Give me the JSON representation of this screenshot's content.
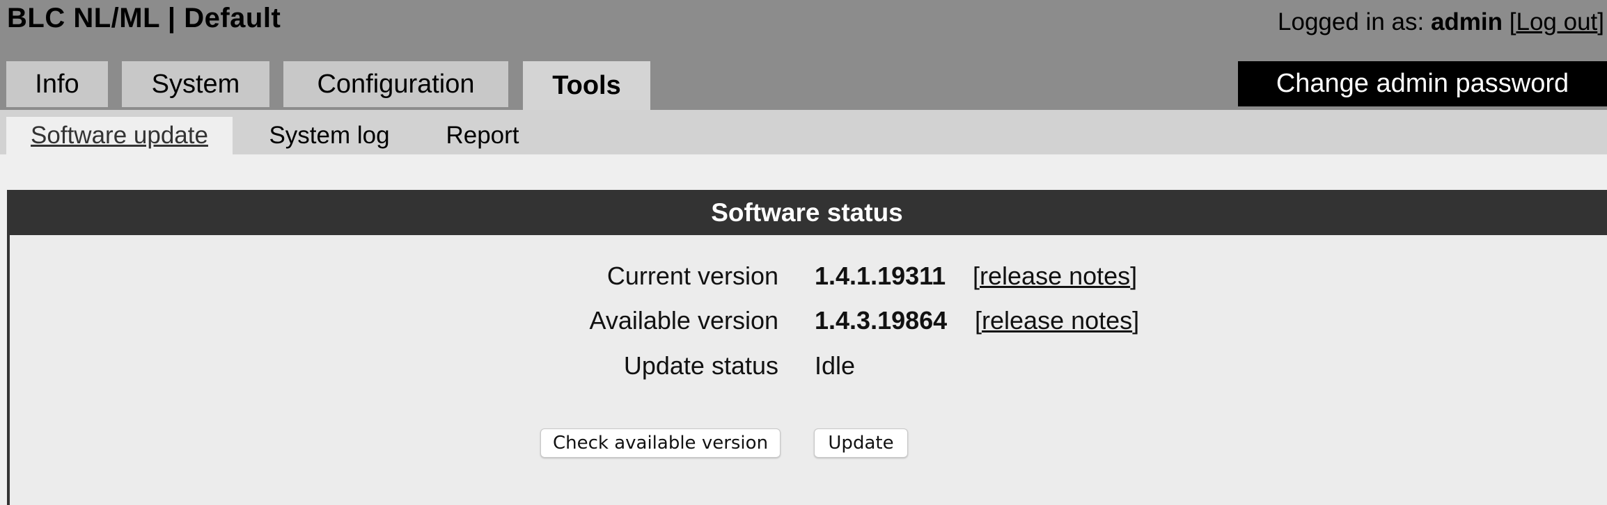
{
  "app": {
    "title": "BLC NL/ML | Default"
  },
  "login": {
    "prefix": "Logged in as: ",
    "user": "admin",
    "bracket_open": "[",
    "logout_label": "Log out",
    "bracket_close": "]"
  },
  "tabs": [
    {
      "label": "Info",
      "active": false
    },
    {
      "label": "System",
      "active": false
    },
    {
      "label": "Configuration",
      "active": false
    },
    {
      "label": "Tools",
      "active": true
    }
  ],
  "change_password_label": "Change admin password",
  "subtabs": [
    {
      "label": "Software update",
      "active": true
    },
    {
      "label": "System log",
      "active": false
    },
    {
      "label": "Report",
      "active": false
    }
  ],
  "panel": {
    "title": "Software status",
    "rows": [
      {
        "label": "Current version",
        "value": "1.4.1.19311",
        "notes_label": "release notes"
      },
      {
        "label": "Available version",
        "value": "1.4.3.19864",
        "notes_label": "release notes"
      },
      {
        "label": "Update status",
        "value": "Idle"
      }
    ],
    "notes_open": "[",
    "notes_close": "]",
    "buttons": {
      "check_label": "Check available version",
      "update_label": "Update"
    }
  },
  "colors": {
    "topbar": "#8c8c8c",
    "tab_bg": "#c8c8c8",
    "active_tab_bg": "#d4d4d4",
    "panel_header": "#333333",
    "accent_button": "#000000"
  }
}
